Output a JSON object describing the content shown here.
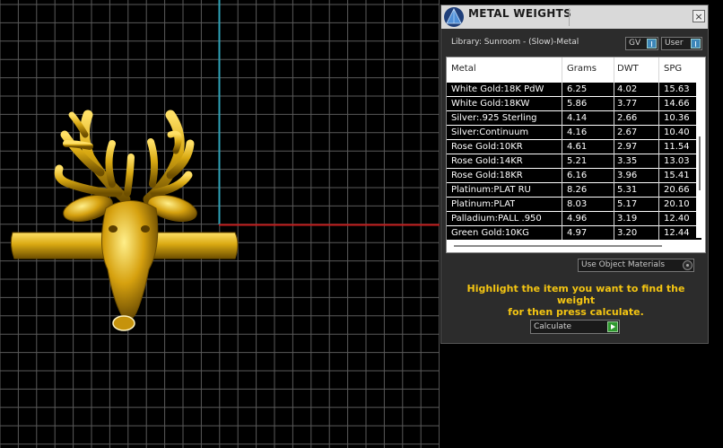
{
  "panel": {
    "title": "METAL WEIGHTS",
    "close_symbol": "×",
    "library_label": "Library: Sunroom - (Slow)-Metal",
    "toggles": [
      {
        "label": "GV",
        "state": "on"
      },
      {
        "label": "User",
        "state": "on"
      }
    ],
    "table": {
      "columns": [
        "Metal",
        "Grams",
        "DWT",
        "SPG"
      ],
      "rows": [
        [
          "White Gold:18K PdW",
          "6.25",
          "4.02",
          "15.63"
        ],
        [
          "White Gold:18KW",
          "5.86",
          "3.77",
          "14.66"
        ],
        [
          "Silver:.925 Sterling",
          "4.14",
          "2.66",
          "10.36"
        ],
        [
          "Silver:Continuum",
          "4.16",
          "2.67",
          "10.40"
        ],
        [
          "Rose Gold:10KR",
          "4.61",
          "2.97",
          "11.54"
        ],
        [
          "Rose Gold:14KR",
          "5.21",
          "3.35",
          "13.03"
        ],
        [
          "Rose Gold:18KR",
          "6.16",
          "3.96",
          "15.41"
        ],
        [
          "Platinum:PLAT RU",
          "8.26",
          "5.31",
          "20.66"
        ],
        [
          "Platinum:PLAT",
          "8.03",
          "5.17",
          "20.10"
        ],
        [
          "Palladium:PALL .950",
          "4.96",
          "3.19",
          "12.40"
        ],
        [
          "Green Gold:10KG",
          "4.97",
          "3.20",
          "12.44"
        ]
      ]
    },
    "material_dropdown": "Use Object Materials",
    "instructions_line1": "Highlight the item you want to find the weight",
    "instructions_line2": "for then press calculate.",
    "calculate_label": "Calculate"
  },
  "colors": {
    "grid": "#5a5a5a",
    "axis_y": "#2fa3b8",
    "axis_x": "#c21b1b",
    "gold": "#d9a912",
    "instruction_text": "#f4c512"
  }
}
